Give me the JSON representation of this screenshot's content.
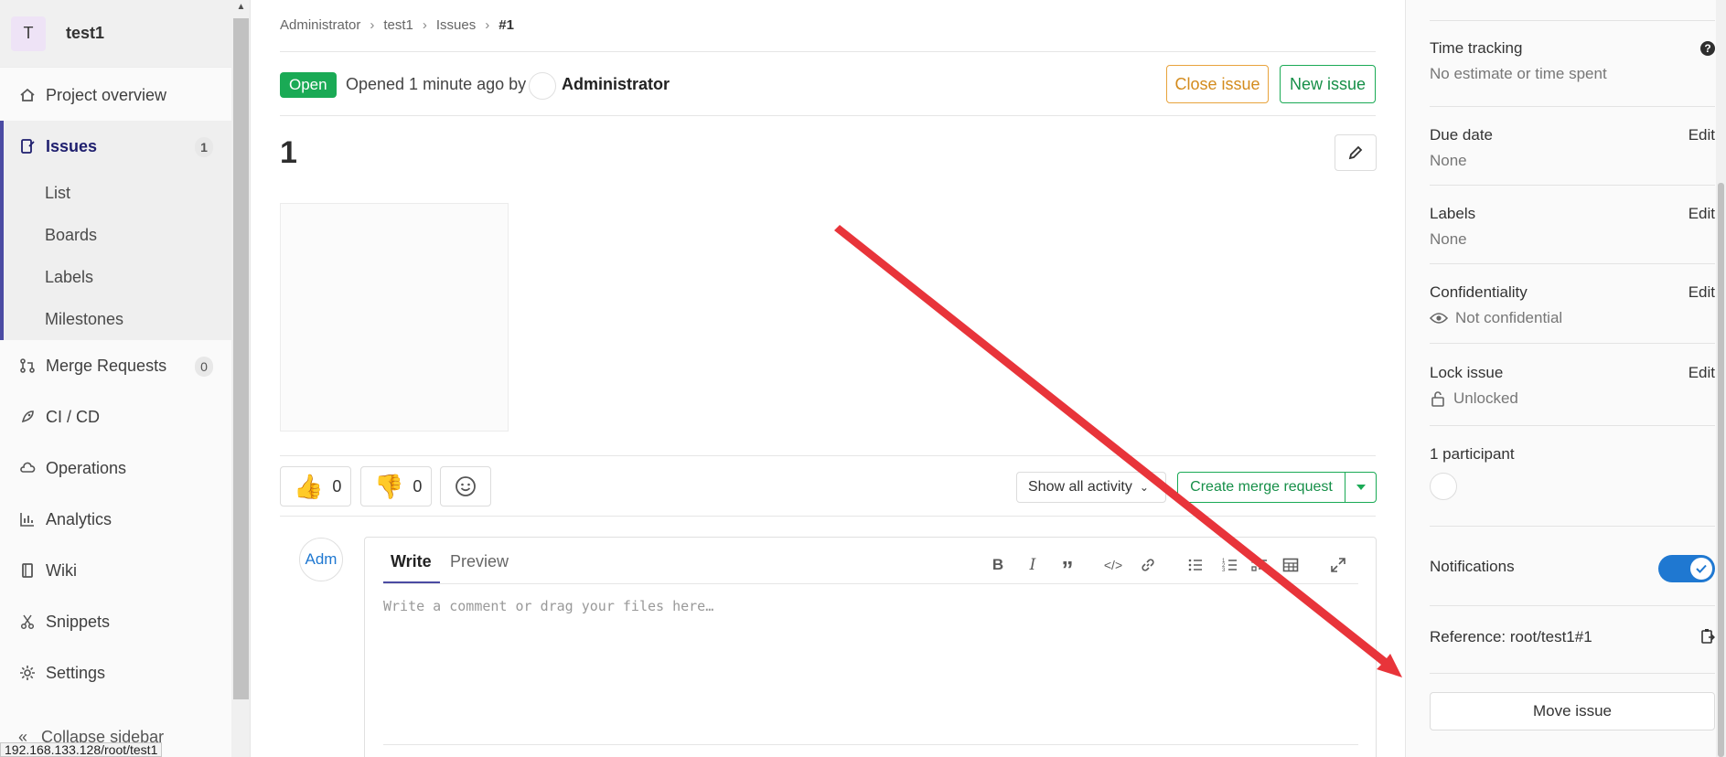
{
  "project": {
    "avatar_letter": "T",
    "name": "test1"
  },
  "nav": {
    "project_overview": "Project overview",
    "issues": {
      "label": "Issues",
      "count": "1"
    },
    "issues_sub": [
      "List",
      "Boards",
      "Labels",
      "Milestones"
    ],
    "merge_requests": {
      "label": "Merge Requests",
      "count": "0"
    },
    "ci_cd": "CI / CD",
    "operations": "Operations",
    "analytics": "Analytics",
    "wiki": "Wiki",
    "snippets": "Snippets",
    "settings": "Settings",
    "collapse": "Collapse sidebar"
  },
  "status_url": "192.168.133.128/root/test1",
  "breadcrumb": [
    "Administrator",
    "test1",
    "Issues",
    "#1"
  ],
  "issue": {
    "status": "Open",
    "opened_text": "Opened 1 minute ago by",
    "author": "Administrator",
    "close_label": "Close issue",
    "new_label": "New issue",
    "title": "1"
  },
  "reactions": {
    "thumbs_up": "0",
    "thumbs_down": "0"
  },
  "activity_filter": "Show all activity",
  "create_mr_label": "Create merge request",
  "comment": {
    "avatar_text": "Adm",
    "write_tab": "Write",
    "preview_tab": "Preview",
    "placeholder": "Write a comment or drag your files here…"
  },
  "sidebar_right": {
    "time_tracking": {
      "label": "Time tracking",
      "value": "No estimate or time spent"
    },
    "due_date": {
      "label": "Due date",
      "value": "None",
      "edit": "Edit"
    },
    "labels": {
      "label": "Labels",
      "value": "None",
      "edit": "Edit"
    },
    "confidentiality": {
      "label": "Confidentiality",
      "value": "Not confidential",
      "edit": "Edit"
    },
    "lock": {
      "label": "Lock issue",
      "value": "Unlocked",
      "edit": "Edit"
    },
    "participants": {
      "label": "1 participant"
    },
    "notifications": {
      "label": "Notifications",
      "enabled": true
    },
    "reference": {
      "label": "Reference: root/test1#1"
    },
    "move_label": "Move issue"
  },
  "colors": {
    "accent_green": "#1aaa55",
    "accent_blue": "#1f78d1",
    "annotation_red": "#e8343a",
    "close_orange": "#e8a33c"
  }
}
